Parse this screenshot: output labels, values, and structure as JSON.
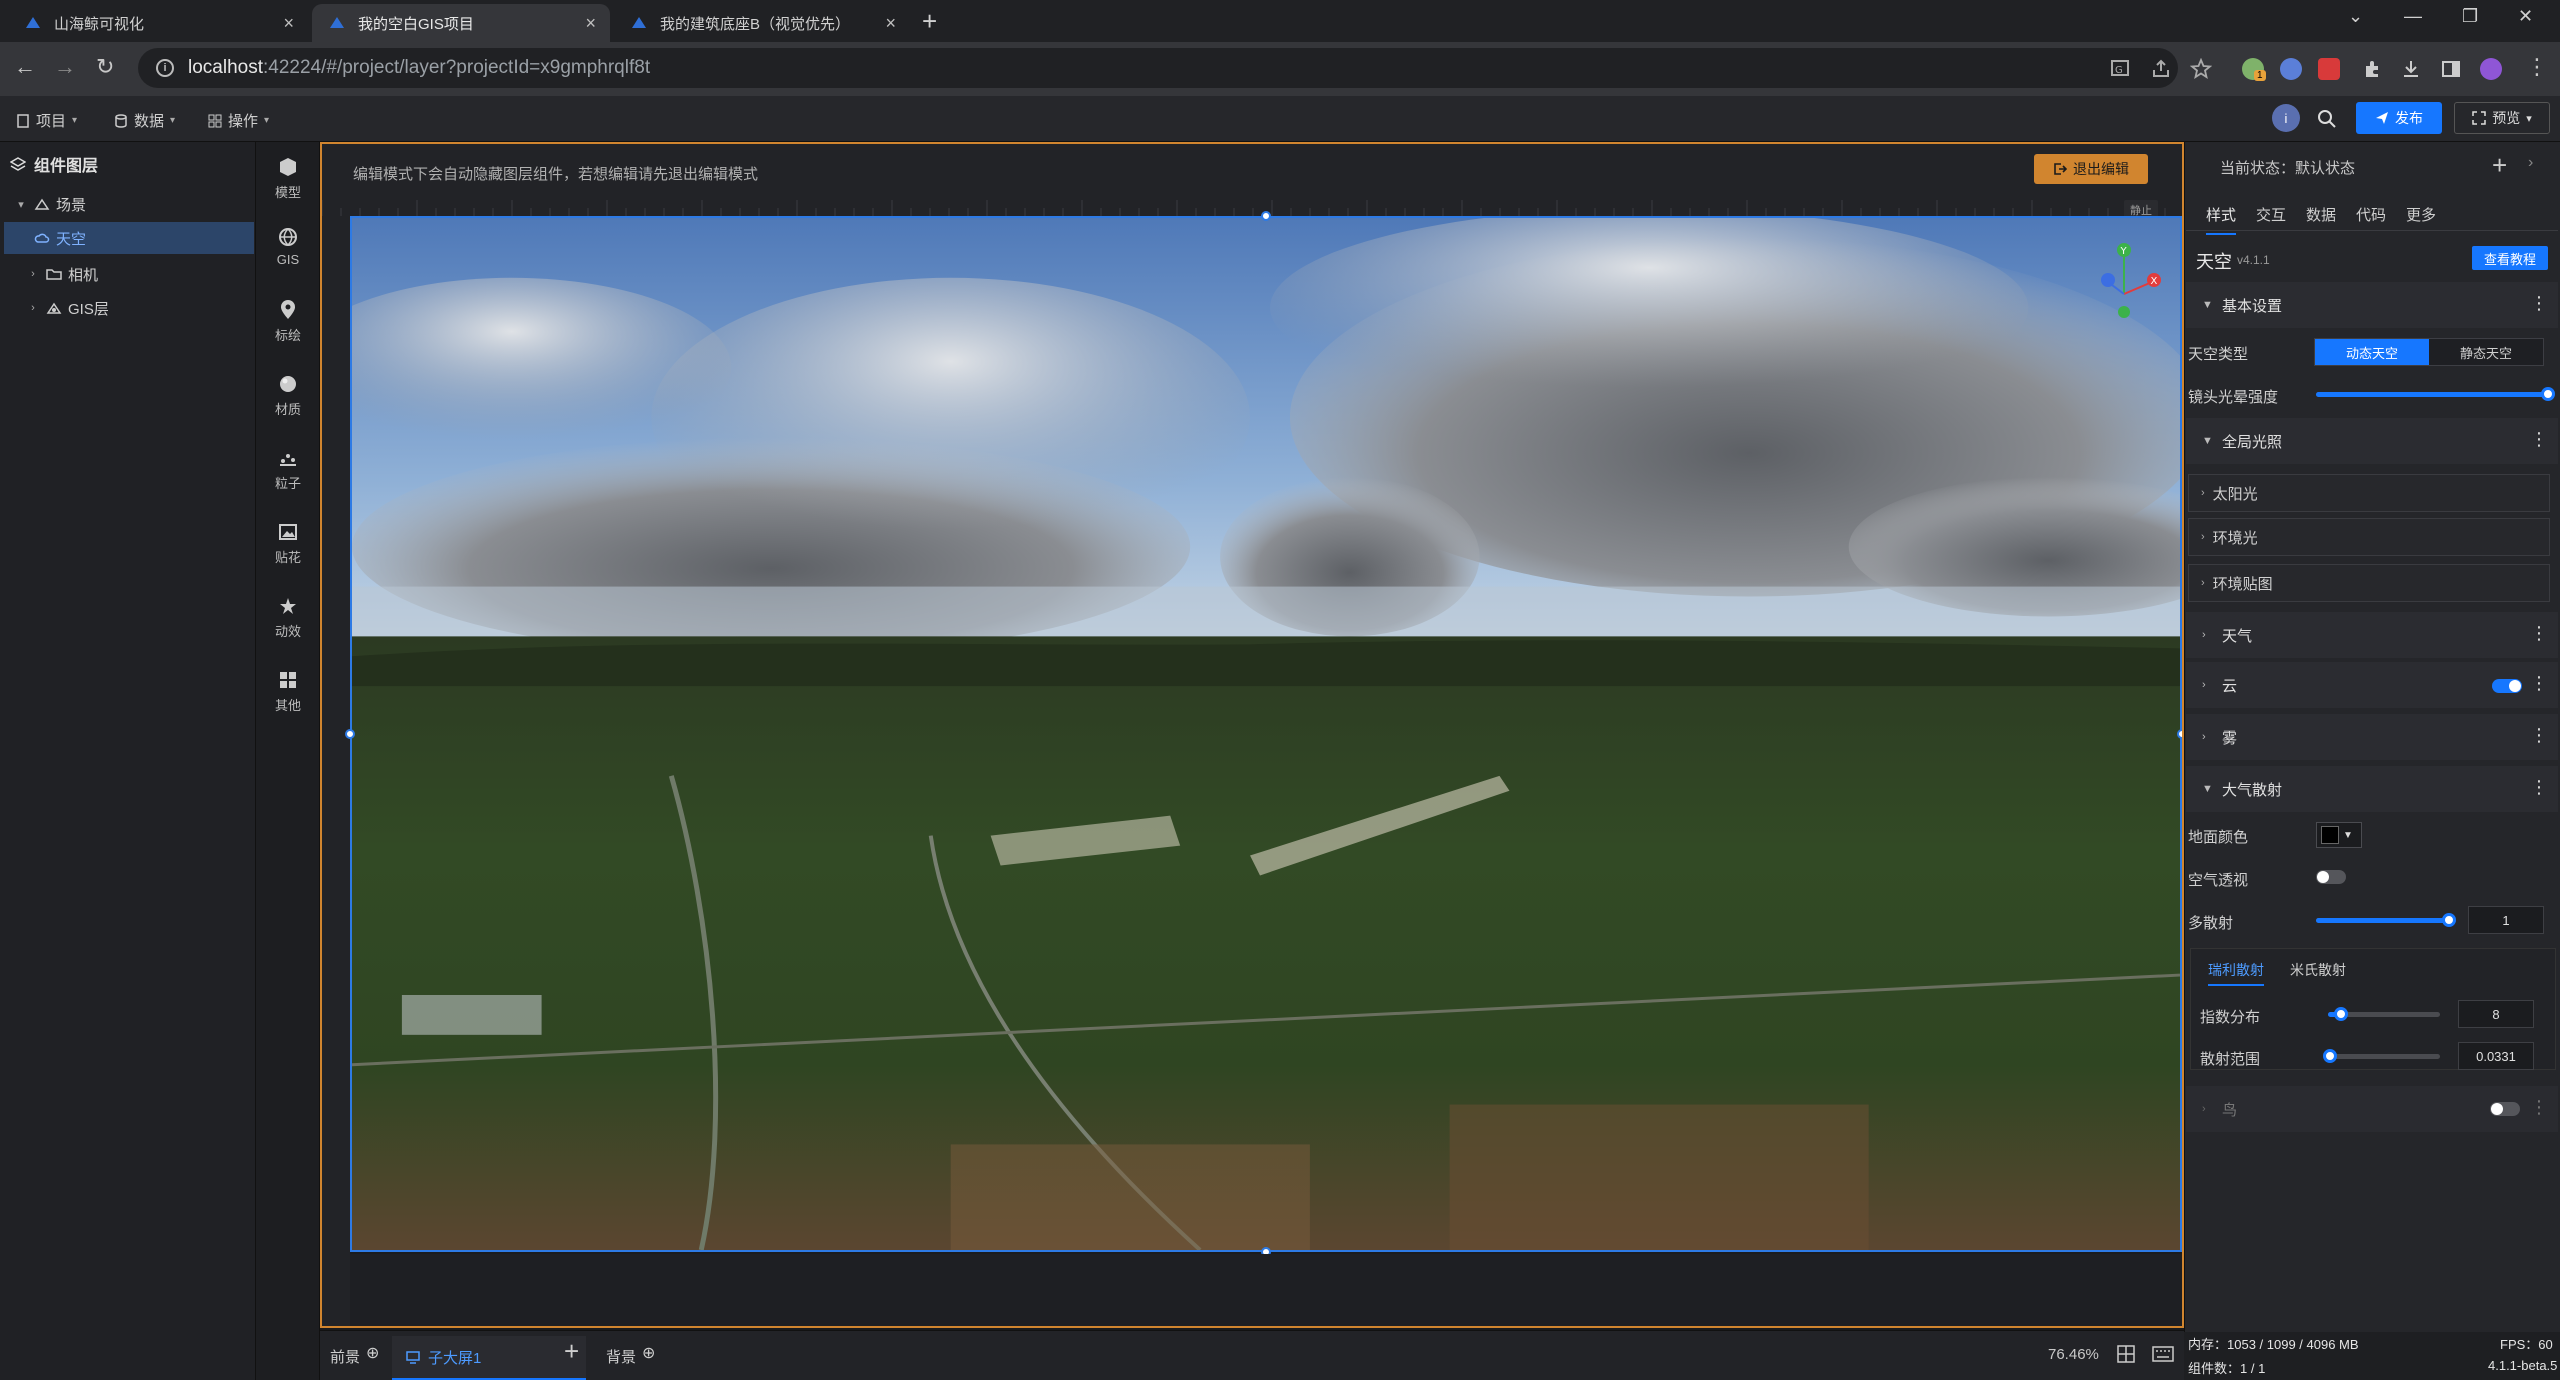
{
  "browser": {
    "tabs": [
      {
        "title": "山海鲸可视化",
        "close": "×"
      },
      {
        "title": "我的空白GIS项目",
        "close": "×"
      },
      {
        "title": "我的建筑底座B（视觉优先）",
        "close": "×"
      }
    ],
    "new_tab": "+",
    "window_controls": {
      "dropdown": "⌄",
      "minimize": "—",
      "restore": "❐",
      "close": "✕"
    },
    "nav": {
      "back": "←",
      "forward": "→",
      "reload": "↻",
      "menu": "⋮"
    },
    "address": {
      "host": "localhost",
      "path": ":42224/#/project/layer?projectId=x9gmphrqlf8t"
    },
    "ext_badge": "1"
  },
  "toolbar": {
    "menus": [
      {
        "label": "项目",
        "caret": "▾"
      },
      {
        "label": "数据",
        "caret": "▾"
      },
      {
        "label": "操作",
        "caret": "▾"
      }
    ],
    "publish": "发布",
    "preview": "预览",
    "preview_caret": "▾",
    "avatar": "i"
  },
  "layers": {
    "title": "组件图层",
    "items": [
      {
        "label": "场景",
        "arrow": "▾"
      },
      {
        "label": "天空",
        "arrow": ""
      },
      {
        "label": "相机",
        "arrow": "›"
      },
      {
        "label": "GIS层",
        "arrow": "›"
      }
    ]
  },
  "components": [
    "模型",
    "GIS",
    "标绘",
    "材质",
    "粒子",
    "贴花",
    "动效",
    "其他"
  ],
  "canvas": {
    "hint": "编辑模式下会自动隐藏图层组件，若想编辑请先退出编辑模式",
    "exit_edit": "退出编辑",
    "lock_tag": "静止",
    "gizmo_axes": [
      "Y",
      "X"
    ]
  },
  "bottom": {
    "foreground": "前景",
    "screen": "子大屏1",
    "add": "+",
    "background": "背景",
    "circle_plus": "⊕",
    "zoom": "76.46%"
  },
  "props": {
    "state_label": "当前状态：默认状态",
    "add_state": "+",
    "state_chevron": "›",
    "tabs": [
      "样式",
      "交互",
      "数据",
      "代码",
      "更多"
    ],
    "component_name": "天空",
    "component_version": "v4.1.1",
    "tutorial": "查看教程",
    "sections": {
      "basic": "基本设置",
      "global_light": "全局光照",
      "sun": "太阳光",
      "ambient": "环境光",
      "env_map": "环境贴图",
      "weather": "天气",
      "cloud": "云",
      "fog": "雾",
      "atmosphere": "大气散射",
      "extra": "鸟"
    },
    "sky_type_label": "天空类型",
    "sky_type_options": [
      "动态天空",
      "静态天空"
    ],
    "sky_type_selected": "动态天空",
    "lens_flare_label": "镜头光晕强度",
    "lens_flare_value": 1.0,
    "ground_color_label": "地面颜色",
    "ground_color": "#000000",
    "air_perspective_label": "空气透视",
    "air_perspective_on": false,
    "cloud_on": true,
    "extra_on": false,
    "multi_scatter_label": "多散射",
    "multi_scatter_value": "1",
    "multi_scatter_fraction": 0.95,
    "scatter_tabs": [
      "瑞利散射",
      "米氏散射"
    ],
    "exp_dist_label": "指数分布",
    "exp_dist_value": "8",
    "exp_dist_fraction": 0.12,
    "scatter_range_label": "散射范围",
    "scatter_range_value": "0.0331",
    "scatter_range_fraction": 0.02,
    "dots": "⋮",
    "tri_open": "▼",
    "tri_closed": "›"
  },
  "status": {
    "memory": "内存：1053 / 1099 / 4096 MB",
    "fps": "FPS：60",
    "components": "组件数：1 / 1",
    "version": "4.1.1-beta.5"
  },
  "colors": {
    "accent": "#1677ff",
    "edit_orange": "#d1852f",
    "selection": "#2c4569"
  }
}
